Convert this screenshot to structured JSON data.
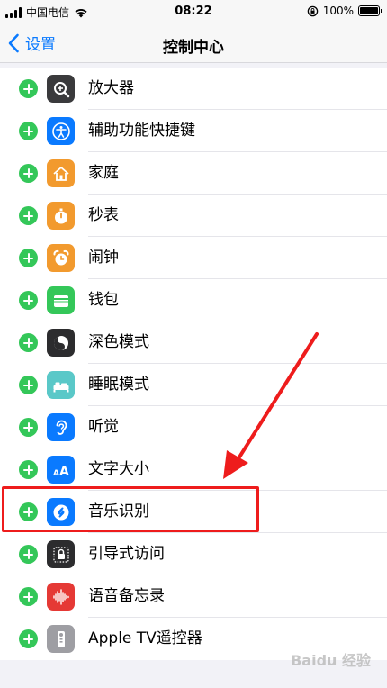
{
  "status_bar": {
    "carrier": "中国电信",
    "time": "08:22",
    "battery_percent": "100%",
    "battery_level": 1.0
  },
  "nav": {
    "back_label": "设置",
    "title": "控制中心"
  },
  "rows": [
    {
      "label": "放大器",
      "icon": "magnifier-icon",
      "icon_bg": "#3a3a3c"
    },
    {
      "label": "辅助功能快捷键",
      "icon": "accessibility-icon",
      "icon_bg": "#0a7aff"
    },
    {
      "label": "家庭",
      "icon": "home-icon",
      "icon_bg": "#f29a2e"
    },
    {
      "label": "秒表",
      "icon": "stopwatch-icon",
      "icon_bg": "#f29a2e"
    },
    {
      "label": "闹钟",
      "icon": "alarm-icon",
      "icon_bg": "#f29a2e"
    },
    {
      "label": "钱包",
      "icon": "wallet-icon",
      "icon_bg": "#34c759"
    },
    {
      "label": "深色模式",
      "icon": "dark-mode-icon",
      "icon_bg": "#2c2c2e"
    },
    {
      "label": "睡眠模式",
      "icon": "bed-icon",
      "icon_bg": "#5ac8c8"
    },
    {
      "label": "听觉",
      "icon": "ear-icon",
      "icon_bg": "#0a7aff"
    },
    {
      "label": "文字大小",
      "icon": "text-size-icon",
      "icon_bg": "#0a7aff"
    },
    {
      "label": "音乐识别",
      "icon": "shazam-icon",
      "icon_bg": "#0a7aff"
    },
    {
      "label": "引导式访问",
      "icon": "guided-access-icon",
      "icon_bg": "#2c2c2e"
    },
    {
      "label": "语音备忘录",
      "icon": "voice-memo-icon",
      "icon_bg": "#e53935"
    },
    {
      "label": "Apple TV遥控器",
      "icon": "tv-remote-icon",
      "icon_bg": "#9e9ea3"
    }
  ],
  "annotation": {
    "highlight_color": "#ee1c1c"
  },
  "watermark": "Baidu 经验"
}
